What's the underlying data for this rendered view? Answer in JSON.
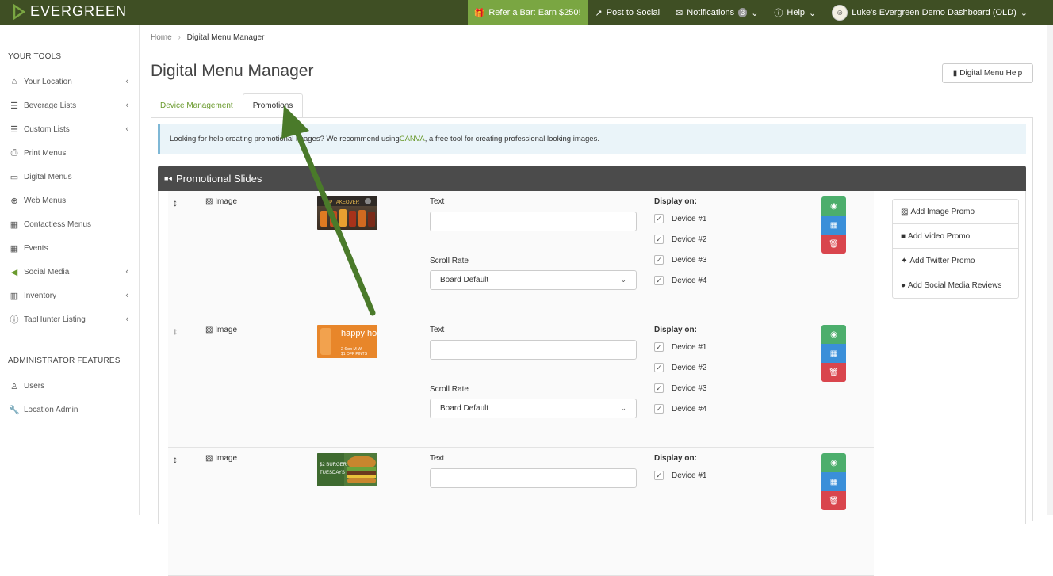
{
  "brand": {
    "name": "EVERGREEN",
    "primary_color": "#3f4f24",
    "accent_color": "#7aa642"
  },
  "topnav": {
    "refer_label": "Refer a Bar: Earn $250!",
    "post_label": "Post to Social",
    "notifications_label": "Notifications",
    "notifications_count": "3",
    "help_label": "Help",
    "account_label": "Luke's Evergreen Demo Dashboard (OLD)"
  },
  "sidebar": {
    "tools_heading": "YOUR TOOLS",
    "items": [
      {
        "label": "Your Location",
        "icon": "home-icon",
        "chevron": true
      },
      {
        "label": "Beverage Lists",
        "icon": "list-icon",
        "chevron": true
      },
      {
        "label": "Custom Lists",
        "icon": "list-icon",
        "chevron": true
      },
      {
        "label": "Print Menus",
        "icon": "printer-icon",
        "chevron": false
      },
      {
        "label": "Digital Menus",
        "icon": "monitor-icon",
        "chevron": false
      },
      {
        "label": "Web Menus",
        "icon": "globe-icon",
        "chevron": false
      },
      {
        "label": "Contactless Menus",
        "icon": "qr-code-icon",
        "chevron": false
      },
      {
        "label": "Events",
        "icon": "calendar-icon",
        "chevron": false
      },
      {
        "label": "Social Media",
        "icon": "megaphone-icon",
        "chevron": true
      },
      {
        "label": "Inventory",
        "icon": "chart-icon",
        "chevron": true
      },
      {
        "label": "TapHunter Listing",
        "icon": "info-icon",
        "chevron": true
      }
    ],
    "admin_heading": "ADMINISTRATOR FEATURES",
    "admin_items": [
      {
        "label": "Users",
        "icon": "user-icon"
      },
      {
        "label": "Location Admin",
        "icon": "wrench-icon"
      }
    ]
  },
  "breadcrumb": {
    "home": "Home",
    "separator": "›",
    "current": "Digital Menu Manager"
  },
  "page": {
    "title": "Digital Menu Manager",
    "help_button": "Digital Menu Help"
  },
  "tabs": [
    {
      "label": "Device Management",
      "active": false
    },
    {
      "label": "Promotions",
      "active": true
    }
  ],
  "info": {
    "before": "Looking for help creating promotional images? We recommend using ",
    "link": "CANVA",
    "after": ", a free tool for creating professional looking images."
  },
  "panel": {
    "title": "Promotional Slides"
  },
  "slides": [
    {
      "type": "Image",
      "thumb_kind": "beer",
      "thumb_text": "TAP TAKEOVER",
      "text_label": "Text",
      "text_value": "",
      "scroll_label": "Scroll Rate",
      "scroll_value": "Board Default",
      "display_label": "Display on:",
      "devices": [
        {
          "label": "Device #1",
          "checked": true
        },
        {
          "label": "Device #2",
          "checked": true
        },
        {
          "label": "Device #3",
          "checked": true
        },
        {
          "label": "Device #4",
          "checked": true
        }
      ]
    },
    {
      "type": "Image",
      "thumb_kind": "happy",
      "thumb_text": "happy hour",
      "thumb_sub1": "2-6pm M-W",
      "thumb_sub2": "$1 OFF PINTS",
      "text_label": "Text",
      "text_value": "",
      "scroll_label": "Scroll Rate",
      "scroll_value": "Board Default",
      "display_label": "Display on:",
      "devices": [
        {
          "label": "Device #1",
          "checked": true
        },
        {
          "label": "Device #2",
          "checked": true
        },
        {
          "label": "Device #3",
          "checked": true
        },
        {
          "label": "Device #4",
          "checked": true
        }
      ]
    },
    {
      "type": "Image",
      "thumb_kind": "burger",
      "thumb_text": "$2 BURGER",
      "thumb_sub1": "TUESDAYS",
      "text_label": "Text",
      "text_value": "",
      "display_label": "Display on:",
      "devices": [
        {
          "label": "Device #1",
          "checked": true
        }
      ]
    }
  ],
  "add_menu": [
    {
      "label": "Add Image Promo",
      "icon": "image-icon"
    },
    {
      "label": "Add Video Promo",
      "icon": "video-icon"
    },
    {
      "label": "Add Twitter Promo",
      "icon": "twitter-icon"
    },
    {
      "label": "Add Social Media Reviews",
      "icon": "comment-icon"
    }
  ],
  "action_colors": {
    "preview": "#4cae6c",
    "schedule": "#3a8fd9",
    "delete": "#d9454d"
  },
  "annotation": {
    "arrow_color": "#4a7a2a"
  }
}
